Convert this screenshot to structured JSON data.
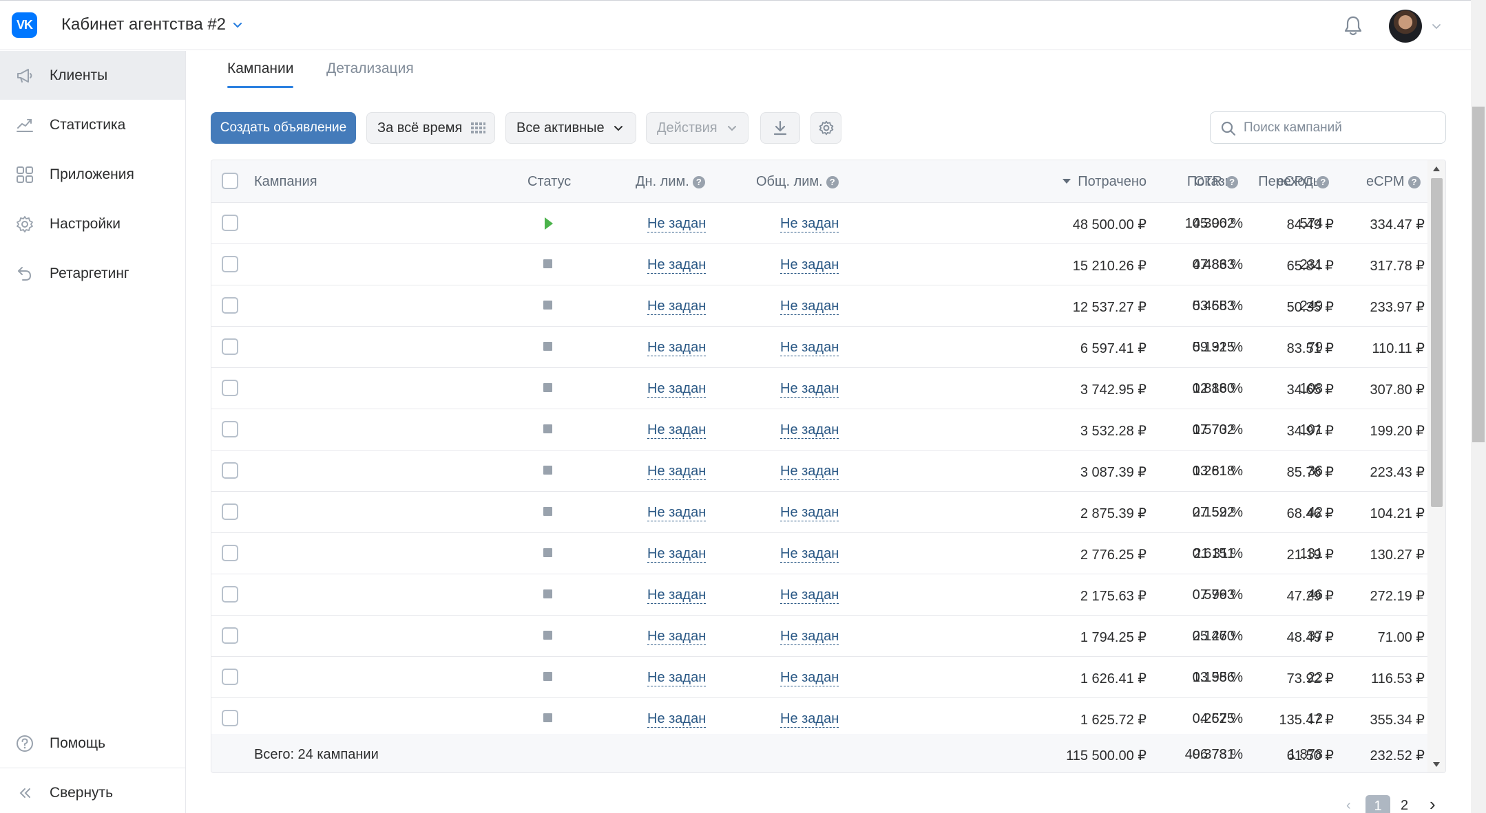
{
  "header": {
    "logo": "VK",
    "cabinet_title": "Кабинет агентства #2"
  },
  "sidebar": {
    "items": [
      {
        "label": "Клиенты",
        "icon": "megaphone-icon",
        "active": true
      },
      {
        "label": "Статистика",
        "icon": "chart-line-icon",
        "active": false
      },
      {
        "label": "Приложения",
        "icon": "apps-grid-icon",
        "active": false
      },
      {
        "label": "Настройки",
        "icon": "gear-icon",
        "active": false
      },
      {
        "label": "Ретаргетинг",
        "icon": "undo-arrow-icon",
        "active": false
      }
    ],
    "help_label": "Помощь",
    "collapse_label": "Свернуть"
  },
  "tabs": [
    {
      "label": "Кампании",
      "active": true
    },
    {
      "label": "Детализация",
      "active": false
    }
  ],
  "toolbar": {
    "create_label": "Создать объявление",
    "period_label": "За всё время",
    "filter_label": "Все активные",
    "actions_label": "Действия",
    "search_placeholder": "Поиск кампаний"
  },
  "table": {
    "columns": {
      "campaign": "Кампания",
      "status": "Статус",
      "daily_limit": "Дн. лим.",
      "total_limit": "Общ. лим.",
      "spent": "Потрачено",
      "impressions": "Показы",
      "clicks": "Переходы",
      "ctr": "CTR",
      "ecpc": "eCPC",
      "ecpm": "eCPM"
    },
    "rows": [
      {
        "status": "active",
        "daily": "Не задан",
        "total": "Не задан",
        "spent": "48 500.00 ₽",
        "impressions": "145 002",
        "clicks": "574",
        "ctr": "0.396 %",
        "ecpc": "84.49 ₽",
        "ecpm": "334.47 ₽"
      },
      {
        "status": "stopped",
        "daily": "Не задан",
        "total": "Не задан",
        "spent": "15 210.26 ₽",
        "impressions": "47 863",
        "clicks": "231",
        "ctr": "0.483 %",
        "ecpc": "65.84 ₽",
        "ecpm": "317.78 ₽"
      },
      {
        "status": "stopped",
        "daily": "Не задан",
        "total": "Не задан",
        "spent": "12 537.27 ₽",
        "impressions": "53 583",
        "clicks": "249",
        "ctr": "0.465 %",
        "ecpc": "50.35 ₽",
        "ecpm": "233.97 ₽"
      },
      {
        "status": "stopped",
        "daily": "Не задан",
        "total": "Не задан",
        "spent": "6 597.41 ₽",
        "impressions": "59 915",
        "clicks": "79",
        "ctr": "0.132 %",
        "ecpc": "83.51 ₽",
        "ecpm": "110.11 ₽"
      },
      {
        "status": "stopped",
        "daily": "Не задан",
        "total": "Не задан",
        "spent": "3 742.95 ₽",
        "impressions": "12 160",
        "clicks": "108",
        "ctr": "0.888 %",
        "ecpc": "34.65 ₽",
        "ecpm": "307.80 ₽"
      },
      {
        "status": "stopped",
        "daily": "Не задан",
        "total": "Не задан",
        "spent": "3 532.28 ₽",
        "impressions": "17 732",
        "clicks": "101",
        "ctr": "0.570 %",
        "ecpc": "34.97 ₽",
        "ecpm": "199.20 ₽"
      },
      {
        "status": "stopped",
        "daily": "Не задан",
        "total": "Не задан",
        "spent": "3 087.39 ₽",
        "impressions": "13 818",
        "clicks": "36",
        "ctr": "0.261 %",
        "ecpc": "85.76 ₽",
        "ecpm": "223.43 ₽"
      },
      {
        "status": "stopped",
        "daily": "Не задан",
        "total": "Не задан",
        "spent": "2 875.39 ₽",
        "impressions": "27 592",
        "clicks": "42",
        "ctr": "0.152 %",
        "ecpc": "68.46 ₽",
        "ecpm": "104.21 ₽"
      },
      {
        "status": "stopped",
        "daily": "Не задан",
        "total": "Не задан",
        "spent": "2 776.25 ₽",
        "impressions": "21 311",
        "clicks": "131",
        "ctr": "0.615 %",
        "ecpc": "21.19 ₽",
        "ecpm": "130.27 ₽"
      },
      {
        "status": "stopped",
        "daily": "Не задан",
        "total": "Не задан",
        "spent": "2 175.63 ₽",
        "impressions": "7 993",
        "clicks": "46",
        "ctr": "0.576 %",
        "ecpc": "47.29 ₽",
        "ecpm": "272.19 ₽"
      },
      {
        "status": "stopped",
        "daily": "Не задан",
        "total": "Не задан",
        "spent": "1 794.25 ₽",
        "impressions": "25 270",
        "clicks": "37",
        "ctr": "0.146 %",
        "ecpc": "48.49 ₽",
        "ecpm": "71.00 ₽"
      },
      {
        "status": "stopped",
        "daily": "Не задан",
        "total": "Не задан",
        "spent": "1 626.41 ₽",
        "impressions": "13 956",
        "clicks": "22",
        "ctr": "0.158 %",
        "ecpc": "73.92 ₽",
        "ecpm": "116.53 ₽"
      },
      {
        "status": "stopped",
        "daily": "Не задан",
        "total": "Не задан",
        "spent": "1 625.72 ₽",
        "impressions": "4 575",
        "clicks": "12",
        "ctr": "0.262 %",
        "ecpc": "135.47 ₽",
        "ecpm": "355.34 ₽"
      }
    ],
    "footer": {
      "label": "Всего: 24 кампании",
      "spent": "115 500.00 ₽",
      "impressions": "496 731",
      "clicks": "1 878",
      "ctr": "0.378 %",
      "ecpc": "61.50 ₽",
      "ecpm": "232.52 ₽"
    }
  },
  "pagination": {
    "prev": "‹",
    "current": "1",
    "next_page": "2",
    "next": "›"
  },
  "colors": {
    "accent": "#447bba",
    "link": "#2a5885",
    "active_status": "#4bb34b",
    "stopped_status": "#99a2ad"
  }
}
